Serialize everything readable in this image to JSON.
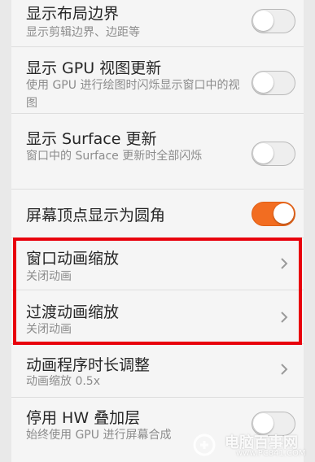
{
  "colors": {
    "accent_toggle_on": "#f26d21",
    "highlight_box": "#e8000c"
  },
  "settings": [
    {
      "title": "显示布局边界",
      "subtitle": "显示剪辑边界、边距等",
      "control": "toggle",
      "state": "off"
    },
    {
      "title": "显示 GPU 视图更新",
      "subtitle": "使用 GPU 进行绘图时闪烁显示窗口中的视图",
      "control": "toggle",
      "state": "off"
    },
    {
      "title": "显示 Surface 更新",
      "subtitle": "窗口中的 Surface 更新时全部闪烁",
      "control": "toggle",
      "state": "off"
    },
    {
      "title": "屏幕顶点显示为圆角",
      "subtitle": "",
      "control": "toggle",
      "state": "on"
    },
    {
      "title": "窗口动画缩放",
      "subtitle": "关闭动画",
      "control": "chevron-right-icon"
    },
    {
      "title": "过渡动画缩放",
      "subtitle": "关闭动画",
      "control": "chevron-right-icon"
    },
    {
      "title": "动画程序时长调整",
      "subtitle": "动画缩放 0.5x",
      "control": "chevron-right-icon"
    },
    {
      "title": "停用 HW 叠加层",
      "subtitle": "始终使用 GPU 进行屏幕合成",
      "control": "toggle",
      "state": "off"
    }
  ],
  "watermark": {
    "text": "电脑百事网",
    "url": "www.PC841.COM"
  }
}
